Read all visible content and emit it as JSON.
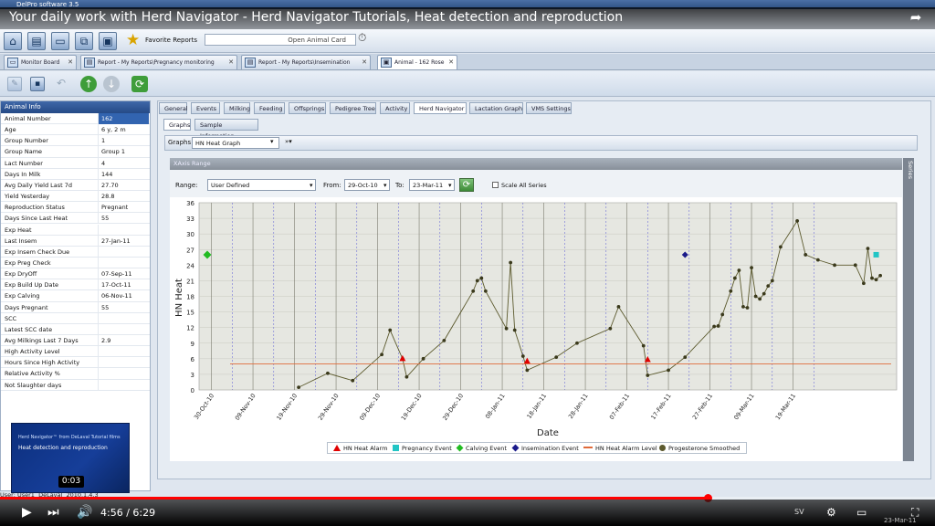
{
  "window": {
    "title": "DelPro software 3.5"
  },
  "video": {
    "title": "Your daily work with Herd Navigator - Herd Navigator Tutorials, Heat detection and reproduction",
    "time": "4:56 / 6:29",
    "progress": 0.757
  },
  "toolbar": {
    "favorite_reports": "Favorite Reports",
    "open_animal_card": "Open Animal Card"
  },
  "doc_tabs": [
    {
      "label": "Monitor Board"
    },
    {
      "label": "Report - My Reports\\Pregnancy monitoring"
    },
    {
      "label": "Report - My Reports\\Insemination"
    },
    {
      "label": "Animal - 162 Rose"
    }
  ],
  "animal_info": {
    "header": "Animal Info",
    "rows": [
      {
        "k": "Animal Number",
        "v": "162"
      },
      {
        "k": "Age",
        "v": "6 y, 2 m"
      },
      {
        "k": "Group Number",
        "v": "1"
      },
      {
        "k": "Group Name",
        "v": "Group 1"
      },
      {
        "k": "Lact Number",
        "v": "4"
      },
      {
        "k": "Days In Milk",
        "v": "144"
      },
      {
        "k": "Avg Daily Yield Last 7d",
        "v": "27.70"
      },
      {
        "k": "Yield Yesterday",
        "v": "28.8"
      },
      {
        "k": "Reproduction Status",
        "v": "Pregnant"
      },
      {
        "k": "Days Since Last Heat",
        "v": "55"
      },
      {
        "k": "Exp Heat",
        "v": ""
      },
      {
        "k": "Last Insem",
        "v": "27-Jan-11"
      },
      {
        "k": "Exp Insem Check Due",
        "v": ""
      },
      {
        "k": "Exp Preg Check",
        "v": ""
      },
      {
        "k": "Exp DryOff",
        "v": "07-Sep-11"
      },
      {
        "k": "Exp Build Up Date",
        "v": "17-Oct-11"
      },
      {
        "k": "Exp Calving",
        "v": "06-Nov-11"
      },
      {
        "k": "Days Pregnant",
        "v": "55"
      },
      {
        "k": "SCC",
        "v": ""
      },
      {
        "k": "Latest SCC date",
        "v": ""
      },
      {
        "k": "Avg Milkings Last 7 Days",
        "v": "2.9"
      },
      {
        "k": "High Activity Level",
        "v": ""
      },
      {
        "k": "Hours Since High Activity",
        "v": ""
      },
      {
        "k": "Relative Activity %",
        "v": ""
      },
      {
        "k": "Not Slaughter days",
        "v": ""
      }
    ]
  },
  "panel_tabs": [
    "General",
    "Events",
    "Milking",
    "Feeding",
    "Offsprings",
    "Pedigree Tree",
    "Activity",
    "Herd Navigator",
    "Lactation Graph",
    "VMS Settings"
  ],
  "sub_tabs": [
    "Graphs",
    "Sample Information"
  ],
  "graphs": {
    "label": "Graphs",
    "selected": "HN Heat Graph",
    "more": "»▾"
  },
  "xaxis_range": {
    "header": "XAxis Range",
    "range_label": "Range:",
    "range_value": "User Defined",
    "from_label": "From:",
    "from_value": "29-Oct-10",
    "to_label": "To:",
    "to_value": "23-Mar-11",
    "scale_all": "Scale All Series"
  },
  "series_strip": "Series",
  "status": {
    "user": "User: User1",
    "brand": "DeLaval",
    "version": "2010.1.4.3"
  },
  "thumbnail": {
    "line1": "Herd Navigator™ from DeLaval Tutorial films",
    "line2": "Heat detection and reproduction",
    "time": "0:03"
  },
  "taskbar": {
    "lang": "SV",
    "date": "23-Mar-11"
  },
  "colors": {
    "accent": "#2d5aa0",
    "series_line": "#5c5a2e",
    "alarm": "#e00000",
    "pregnancy": "#22c5c5",
    "calving": "#22bb22",
    "insemination": "#1a1a8a",
    "alarm_level": "#e06a3a"
  },
  "chart_data": {
    "type": "line",
    "xlabel": "Date",
    "ylabel": "HN Heat",
    "ylim": [
      0,
      36
    ],
    "y_ticks": [
      0,
      3,
      6,
      9,
      12,
      15,
      18,
      21,
      24,
      27,
      30,
      33,
      36
    ],
    "x_tick_labels": [
      "30-Oct-10",
      "09-Nov-10",
      "19-Nov-10",
      "29-Nov-10",
      "09-Dec-10",
      "19-Dec-10",
      "29-Dec-10",
      "08-Jan-11",
      "18-Jan-11",
      "28-Jan-11",
      "07-Feb-11",
      "17-Feb-11",
      "27-Feb-11",
      "09-Mar-11",
      "19-Mar-11"
    ],
    "x_range": [
      "2010-10-29",
      "2011-03-23"
    ],
    "grid": true,
    "legend_placement": "bottom",
    "series": [
      {
        "name": "Progesterone Smoothed",
        "kind": "line",
        "points": [
          [
            "2010-11-20",
            0.5
          ],
          [
            "2010-11-27",
            3.2
          ],
          [
            "2010-12-03",
            1.8
          ],
          [
            "2010-12-10",
            6.8
          ],
          [
            "2010-12-12",
            11.5
          ],
          [
            "2010-12-15",
            6.0
          ],
          [
            "2010-12-16",
            2.5
          ],
          [
            "2010-12-20",
            6.0
          ],
          [
            "2010-12-25",
            9.5
          ],
          [
            "2011-01-01",
            19.0
          ],
          [
            "2011-01-02",
            21.0
          ],
          [
            "2011-01-03",
            21.5
          ],
          [
            "2011-01-04",
            19.0
          ],
          [
            "2011-01-09",
            11.8
          ],
          [
            "2011-01-10",
            24.5
          ],
          [
            "2011-01-11",
            11.5
          ],
          [
            "2011-01-13",
            6.5
          ],
          [
            "2011-01-14",
            3.8
          ],
          [
            "2011-01-21",
            6.3
          ],
          [
            "2011-01-26",
            9.0
          ],
          [
            "2011-02-03",
            11.8
          ],
          [
            "2011-02-05",
            16.0
          ],
          [
            "2011-02-11",
            8.5
          ],
          [
            "2011-02-12",
            2.8
          ],
          [
            "2011-02-17",
            3.8
          ],
          [
            "2011-02-21",
            6.3
          ],
          [
            "2011-02-28",
            12.2
          ],
          [
            "2011-03-01",
            12.3
          ],
          [
            "2011-03-02",
            14.5
          ],
          [
            "2011-03-04",
            19.0
          ],
          [
            "2011-03-05",
            21.5
          ],
          [
            "2011-03-06",
            23.0
          ],
          [
            "2011-03-07",
            16.0
          ],
          [
            "2011-03-08",
            15.8
          ],
          [
            "2011-03-09",
            23.5
          ],
          [
            "2011-03-10",
            18.0
          ],
          [
            "2011-03-11",
            17.5
          ],
          [
            "2011-03-12",
            18.5
          ],
          [
            "2011-03-13",
            20.0
          ],
          [
            "2011-03-14",
            21.0
          ],
          [
            "2011-03-16",
            27.5
          ],
          [
            "2011-03-20",
            32.5
          ],
          [
            "2011-03-22",
            26.0
          ],
          [
            "2011-03-25",
            25.0
          ],
          [
            "2011-03-29",
            24.0
          ],
          [
            "2011-04-03",
            24.0
          ],
          [
            "2011-04-05",
            20.5
          ],
          [
            "2011-04-06",
            27.2
          ],
          [
            "2011-04-07",
            21.5
          ],
          [
            "2011-04-08",
            21.2
          ],
          [
            "2011-04-09",
            22.0
          ]
        ]
      },
      {
        "name": "HN Heat Alarm Level",
        "kind": "hline",
        "y": 5
      },
      {
        "name": "HN Heat Alarm",
        "kind": "marker",
        "shape": "triangle",
        "points": [
          [
            "2010-12-15",
            6.0
          ],
          [
            "2011-01-14",
            5.5
          ],
          [
            "2011-02-12",
            5.8
          ]
        ]
      },
      {
        "name": "Pregnancy Event",
        "kind": "marker",
        "shape": "square",
        "points": [
          [
            "2011-04-08",
            26.0
          ]
        ]
      },
      {
        "name": "Calving Event",
        "kind": "marker",
        "shape": "diamond",
        "points": [
          [
            "2010-10-29",
            26.0
          ]
        ]
      },
      {
        "name": "Insemination Event",
        "kind": "marker",
        "shape": "diamond",
        "points": [
          [
            "2011-02-21",
            26.0
          ]
        ]
      }
    ]
  }
}
